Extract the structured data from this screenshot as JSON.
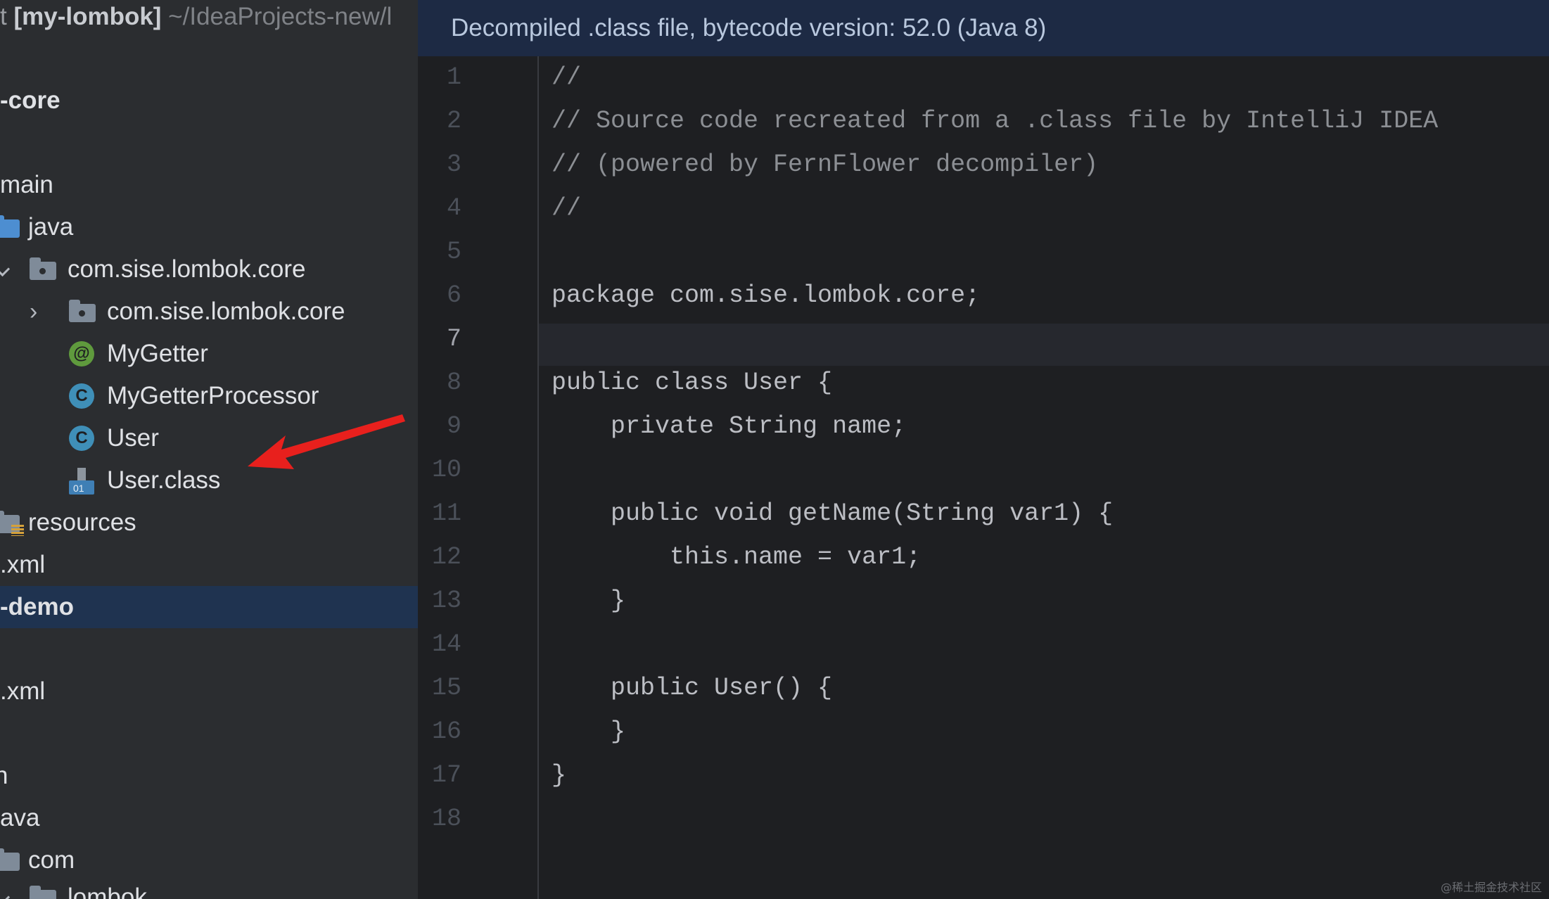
{
  "project_header": {
    "prefix": "t ",
    "project_name": "[my-lombok]",
    "path": " ~/IdeaProjects-new/l"
  },
  "tree": [
    {
      "label": "-core",
      "icon": ""
    },
    {
      "label": "main",
      "icon": ""
    },
    {
      "label": "java",
      "icon": "source-folder-icon"
    },
    {
      "label": "com.sise.lombok.core",
      "icon": "package-icon"
    },
    {
      "label": "com.sise.lombok.core",
      "icon": "package-icon"
    },
    {
      "label": "MyGetter",
      "icon": "annotation-icon",
      "glyph": "@"
    },
    {
      "label": "MyGetterProcessor",
      "icon": "class-icon",
      "glyph": "C"
    },
    {
      "label": "User",
      "icon": "class-icon",
      "glyph": "C"
    },
    {
      "label": "User.class",
      "icon": "class-file-icon"
    },
    {
      "label": "resources",
      "icon": "resources-folder-icon"
    },
    {
      "label": ".xml",
      "icon": ""
    },
    {
      "label": "-demo",
      "icon": "",
      "selected": true
    },
    {
      "label": ".xml",
      "icon": ""
    },
    {
      "label": "n",
      "icon": ""
    },
    {
      "label": "ava",
      "icon": ""
    },
    {
      "label": "com",
      "icon": "folder-icon"
    },
    {
      "label": "lombok",
      "icon": "folder-icon"
    }
  ],
  "editor": {
    "banner": "Decompiled .class file, bytecode version: 52.0 (Java 8)",
    "current_line": 7,
    "lines": [
      {
        "n": "1",
        "text": "//"
      },
      {
        "n": "2",
        "text": "// Source code recreated from a .class file by IntelliJ IDEA"
      },
      {
        "n": "3",
        "text": "// (powered by FernFlower decompiler)"
      },
      {
        "n": "4",
        "text": "//"
      },
      {
        "n": "5",
        "text": ""
      },
      {
        "n": "6",
        "text": "package com.sise.lombok.core;"
      },
      {
        "n": "7",
        "text": ""
      },
      {
        "n": "8",
        "text": "public class User {"
      },
      {
        "n": "9",
        "text": "    private String name;"
      },
      {
        "n": "10",
        "text": ""
      },
      {
        "n": "11",
        "text": "    public void getName(String var1) {"
      },
      {
        "n": "12",
        "text": "        this.name = var1;"
      },
      {
        "n": "13",
        "text": "    }"
      },
      {
        "n": "14",
        "text": ""
      },
      {
        "n": "15",
        "text": "    public User() {"
      },
      {
        "n": "16",
        "text": "    }"
      },
      {
        "n": "17",
        "text": "}"
      },
      {
        "n": "18",
        "text": ""
      }
    ]
  },
  "watermark": "@稀土掘金技术社区",
  "colors": {
    "annotation_arrow": "#e8201d",
    "selection": "#1f3350",
    "banner": "#1d2a44"
  }
}
